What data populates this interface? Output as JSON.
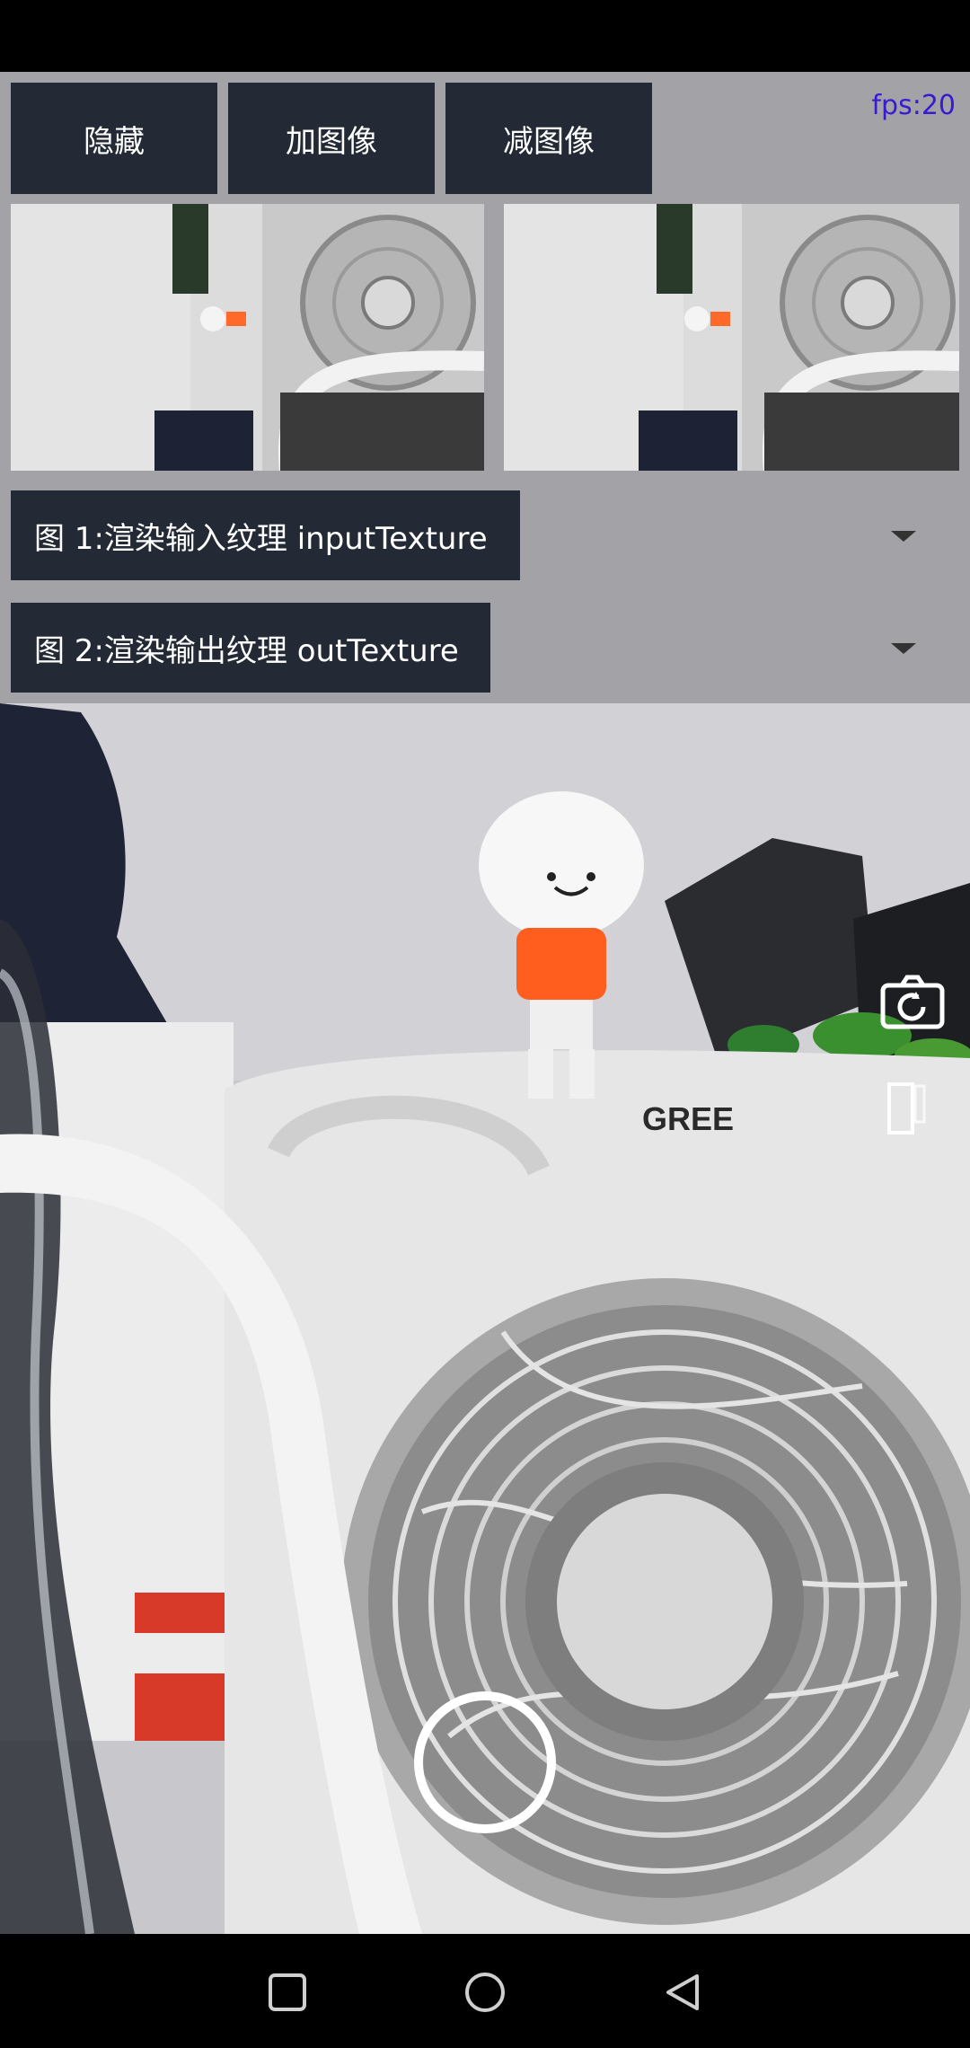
{
  "toolbar": {
    "hide_label": "隐藏",
    "add_image_label": "加图像",
    "remove_image_label": "减图像"
  },
  "fps_text": "fps:20",
  "texture_rows": [
    {
      "label": "图 1:渲染输入纹理 inputTexture"
    },
    {
      "label": "图 2:渲染输出纹理 outTexture"
    }
  ],
  "camera": {
    "brand_text": "GREE"
  },
  "icons": {
    "switch_camera": "camera-switch-icon",
    "flash": "flash-toggle-icon",
    "shutter": "shutter-button",
    "nav_recent": "square-recent-icon",
    "nav_home": "circle-home-icon",
    "nav_back": "triangle-back-icon"
  },
  "colors": {
    "panel_bg": "#a3a2a7",
    "button_bg": "#242a35",
    "fps_color": "#3a1ad0"
  }
}
